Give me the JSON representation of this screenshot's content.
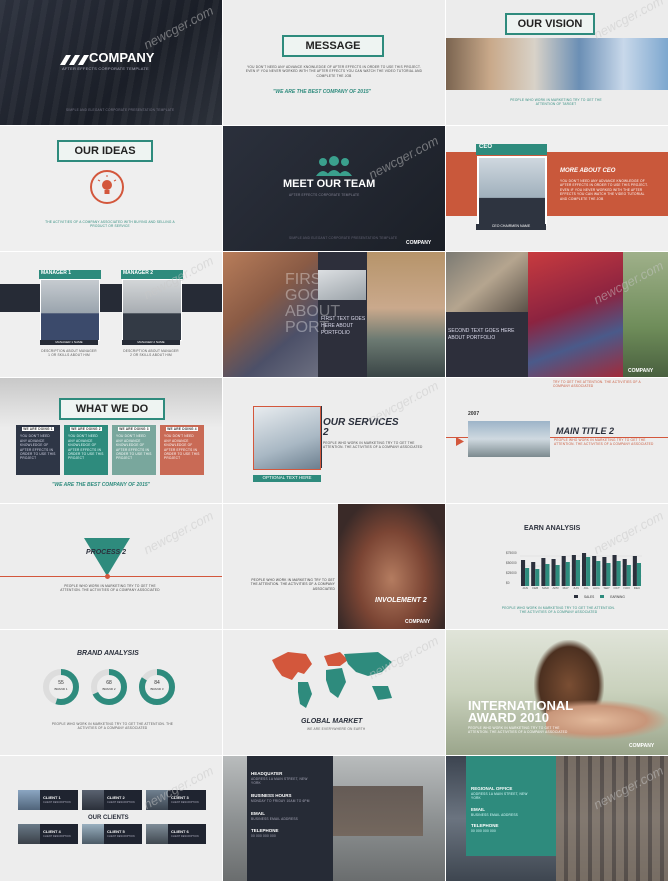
{
  "watermark": "newcger.com",
  "colors": {
    "teal": "#2e8b7d",
    "orange": "#d3573c",
    "dark": "#1f2430"
  },
  "s1": {
    "brand": "COMPANY",
    "subtitle": "AFTER EFFECTS CORPORATE TEMPLATE",
    "foot": "SIMPLE AND ELEGANT CORPORATE PRESENTATION TEMPLATE"
  },
  "s2": {
    "title": "MESSAGE",
    "body": "YOU DON'T NEED ANY ADVANCE KNOWLEDGE OF AFTER EFFECTS IN ORDER TO USE THIS PROJECT. EVEN IF YOU NEVER WORKED WITH THE AFTER EFFECTS YOU CAN WATCH THE VIDEO TUTORIAL AND COMPLETE THE JOB",
    "quote": "\"WE ARE THE BEST COMPANY OF 2015\""
  },
  "s3": {
    "title": "OUR VISION",
    "body": "PEOPLE WHO WORK IN MARKETING TRY TO GET THE ATTENTION OF TARGET"
  },
  "s4": {
    "title": "OUR IDEAS",
    "body": "THE ACTIVITIES OF A COMPANY ASSOCIATED WITH BUYING AND SELLING A PRODUCT OR SERVICE"
  },
  "s5": {
    "title": "MEET OUR TEAM",
    "subtitle": "AFTER EFFECTS CORPORATE TEMPLATE",
    "foot": "SIMPLE AND ELEGANT CORPORATE PRESENTATION TEMPLATE",
    "brand": "COMPANY"
  },
  "s6": {
    "tag": "CEO",
    "heading": "MORE ABOUT CEO",
    "body": "YOU DON'T NEED ANY ADVANCE KNOWLEDGE OF AFTER EFFECTS IN ORDER TO USE THIS PROJECT. EVEN IF YOU NEVER WORKED WITH THE AFTER EFFECTS YOU CAN WATCH THE VIDEO TUTORIAL AND COMPLETE THE JOB",
    "caption": "CEO CHAIRMEN NAME"
  },
  "s7": {
    "m1": "MANAGER 1",
    "m2": "MANAGER 2",
    "n1": "MANAGER 1 NAME",
    "n2": "MANAGER 2 NAME",
    "d1": "DESCRIPTION ABOUT MANAGER 1 OR SKILLS ABOUT HIM",
    "d2": "DESCRIPTION ABOUT MANAGER 2 OR SKILLS ABOUT HIM"
  },
  "s8": {
    "big": "FIRST GOOD ABOUT PORT",
    "text": "FIRST TEXT GOES HERE ABOUT PORTFOLIO"
  },
  "s9": {
    "text": "SECOND TEXT GOES HERE ABOUT PORTFOLIO",
    "brand": "COMPANY"
  },
  "s10": {
    "title": "WHAT WE DO",
    "cards": [
      {
        "h": "WE ARE DOING 1",
        "b": "YOU DON'T NEED ANY ADVANCE KNOWLEDGE OF AFTER EFFECTS IN ORDER TO USE THIS PROJECT"
      },
      {
        "h": "WE ARE DOING 2",
        "b": "YOU DON'T NEED ANY ADVANCE KNOWLEDGE OF AFTER EFFECTS IN ORDER TO USE THIS PROJECT"
      },
      {
        "h": "WE ARE DOING 3",
        "b": "YOU DON'T NEED ANY ADVANCE KNOWLEDGE OF AFTER EFFECTS IN ORDER TO USE THIS PROJECT"
      },
      {
        "h": "WE ARE DOING 4",
        "b": "YOU DON'T NEED ANY ADVANCE KNOWLEDGE OF AFTER EFFECTS IN ORDER TO USE THIS PROJECT"
      }
    ],
    "quote": "\"WE ARE THE BEST COMPANY OF 2015\""
  },
  "s11": {
    "title": "OUR SERVICES 2",
    "body": "PEOPLE WHO WORK IN MARKETING TRY TO GET THE ATTENTION. THE ACTIVITIES OF A COMPANY ASSOCIATED",
    "caption": "OPTIONAL TEXT HERE"
  },
  "s12": {
    "top": "TRY TO GET THE ATTENTION. THE ACTIVITIES OF A COMPANY ASSOCIATED",
    "year": "2007",
    "title": "MAIN TITLE 2",
    "body": "PEOPLE WHO WORK IN MARKETING TRY TO GET THE ATTENTION. THE ACTIVITIES OF A COMPANY ASSOCIATED"
  },
  "s13": {
    "title": "PROCESS 2",
    "body": "PEOPLE WHO WORK IN MARKETING TRY TO GET THE ATTENTION. THE ACTIVITIES OF A COMPANY ASSOCIATED"
  },
  "s14": {
    "text": "PEOPLE WHO WORK IN MARKETING TRY TO GET THE ATTENTION. THE ACTIVITIES OF A COMPANY ASSOCIATED",
    "caption": "INVOLEMENT 2",
    "brand": "COMPANY"
  },
  "s15": {
    "title": "EARN ANALYSIS",
    "legend": [
      "SALES",
      "EARNING"
    ],
    "yticks": [
      "$75000",
      "$50000",
      "$25000",
      "$0"
    ],
    "months": [
      "JAN",
      "FEB",
      "MAR",
      "APR",
      "MAY",
      "JUN",
      "JUL",
      "AUG",
      "SEP",
      "OCT",
      "NOV",
      "DEC"
    ],
    "body": "PEOPLE WHO WORK IN MARKETING TRY TO GET THE ATTENTION. THE ACTIVITIES OF A COMPANY ASSOCIATED"
  },
  "s16": {
    "title": "BRAND ANALYSIS",
    "rings": [
      {
        "v": "55",
        "l": "BRAND 1"
      },
      {
        "v": "68",
        "l": "BRAND 2"
      },
      {
        "v": "84",
        "l": "BRAND 3"
      }
    ],
    "body": "PEOPLE WHO WORK IN MARKETING TRY TO GET THE ATTENTION. THE ACTIVITIES OF A COMPANY ASSOCIATED"
  },
  "s17": {
    "title": "GLOBAL MARKET",
    "sub": "WE ARE EVERYWHERE ON EARTH"
  },
  "s18": {
    "title": "INTERNATIONAL AWARD 2010",
    "body": "PEOPLE WHO WORK IN MARKETING TRY TO GET THE ATTENTION. THE ACTIVITIES OF A COMPANY ASSOCIATED",
    "brand": "COMPANY"
  },
  "s19": {
    "title": "OUR CLIENTS",
    "clients": [
      "CLIENT 1",
      "CLIENT 2",
      "CLIENT 3",
      "CLIENT 4",
      "CLIENT 5",
      "CLIENT 6"
    ],
    "sub": "CLIENT DESCRIPTION"
  },
  "s20": {
    "rows": [
      {
        "h": "HEADQUATER",
        "b": "ADDRESS 1A MAIN STREET, NEW YORK"
      },
      {
        "h": "BUSINESS HOURS",
        "b": "MONDAY TO FRIDAY 10AM TO 6PM"
      },
      {
        "h": "EMAIL",
        "b": "BUSINESS EMAIL ADDRESS"
      },
      {
        "h": "TELEPHONE",
        "b": "00 000 000 000"
      }
    ]
  },
  "s21": {
    "rows": [
      {
        "h": "REGIONAL OFFICE",
        "b": "ADDRESS 1A MAIN STREET, NEW YORK"
      },
      {
        "h": "EMAIL",
        "b": "BUSINESS EMAIL ADDRESS"
      },
      {
        "h": "TELEPHONE",
        "b": "00 000 000 000"
      }
    ]
  }
}
